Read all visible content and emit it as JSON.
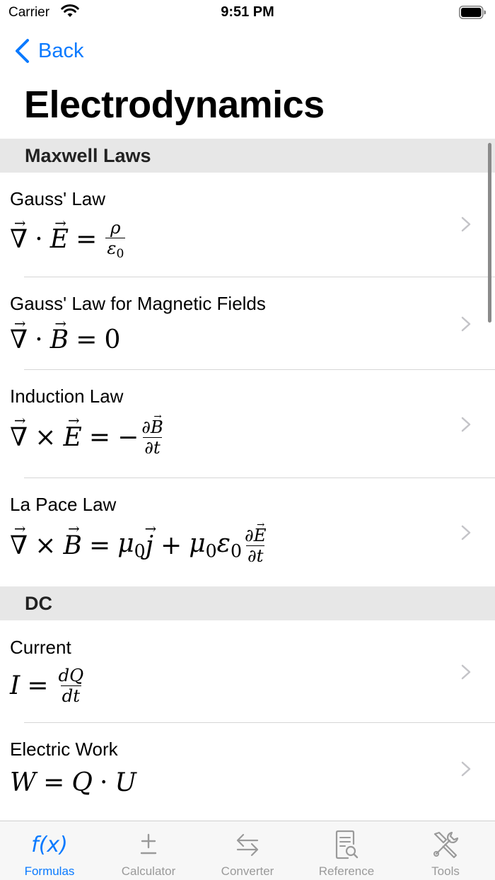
{
  "status": {
    "carrier": "Carrier",
    "time": "9:51 PM"
  },
  "nav": {
    "back": "Back",
    "title": "Electrodynamics"
  },
  "sections": [
    {
      "header": "Maxwell Laws",
      "rows": [
        {
          "title": "Gauss' Law"
        },
        {
          "title": "Gauss' Law for Magnetic Fields"
        },
        {
          "title": "Induction Law"
        },
        {
          "title": "La Pace Law"
        }
      ]
    },
    {
      "header": "DC",
      "rows": [
        {
          "title": "Current"
        },
        {
          "title": "Electric Work"
        }
      ]
    }
  ],
  "tabs": [
    {
      "label": "Formulas",
      "icon": "function-icon",
      "active": true
    },
    {
      "label": "Calculator",
      "icon": "plus-minus-icon",
      "active": false
    },
    {
      "label": "Converter",
      "icon": "arrows-exchange-icon",
      "active": false
    },
    {
      "label": "Reference",
      "icon": "document-search-icon",
      "active": false
    },
    {
      "label": "Tools",
      "icon": "tools-icon",
      "active": false
    }
  ],
  "colors": {
    "accent": "#0a7aff",
    "section_bg": "#e7e7e7",
    "tab_inactive": "#9a9a9a"
  }
}
